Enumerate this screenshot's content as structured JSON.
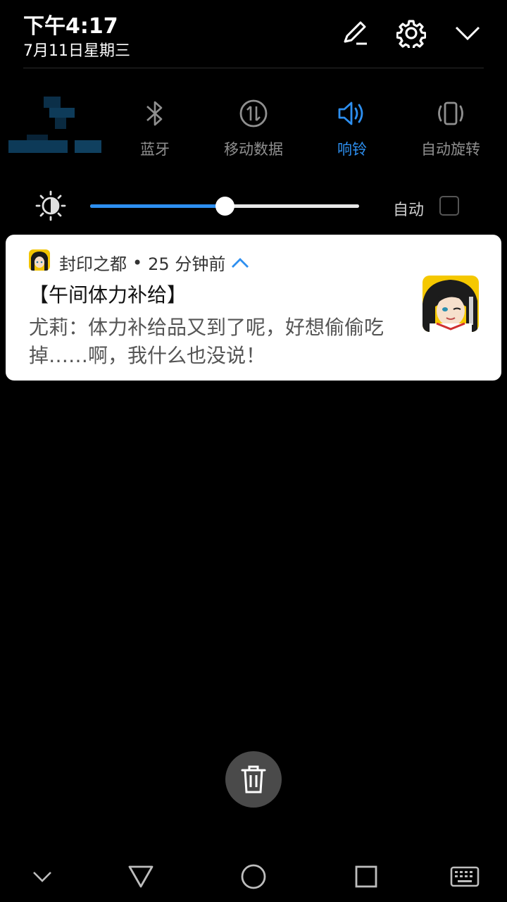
{
  "status": {
    "time": "下午4:17",
    "date": "7月11日星期三"
  },
  "header_icons": [
    "edit-icon",
    "gear-icon",
    "chevron-down-icon"
  ],
  "toggles": [
    {
      "label": "蓝牙",
      "icon": "bluetooth-icon",
      "active": false
    },
    {
      "label": "移动数据",
      "icon": "mobile-data-icon",
      "active": false
    },
    {
      "label": "响铃",
      "icon": "speaker-icon",
      "active": true
    },
    {
      "label": "自动旋转",
      "icon": "auto-rotate-icon",
      "active": false
    }
  ],
  "brightness": {
    "level": 0.5,
    "auto_label": "自动",
    "auto_checked": false
  },
  "notification": {
    "app_name": "封印之都",
    "separator": "•",
    "time_ago": "25 分钟前",
    "title": "【午间体力补给】",
    "body": "尤莉：体力补给品又到了呢，好想偷偷吃掉……啊，我什么也没说！"
  },
  "nav_icons": [
    "chevron-down-icon",
    "back-icon",
    "home-icon",
    "recents-icon",
    "keyboard-icon"
  ],
  "colors": {
    "accent": "#2d8ff0",
    "background": "#000000",
    "inactive": "#8f8f8f",
    "card": "#ffffff"
  }
}
